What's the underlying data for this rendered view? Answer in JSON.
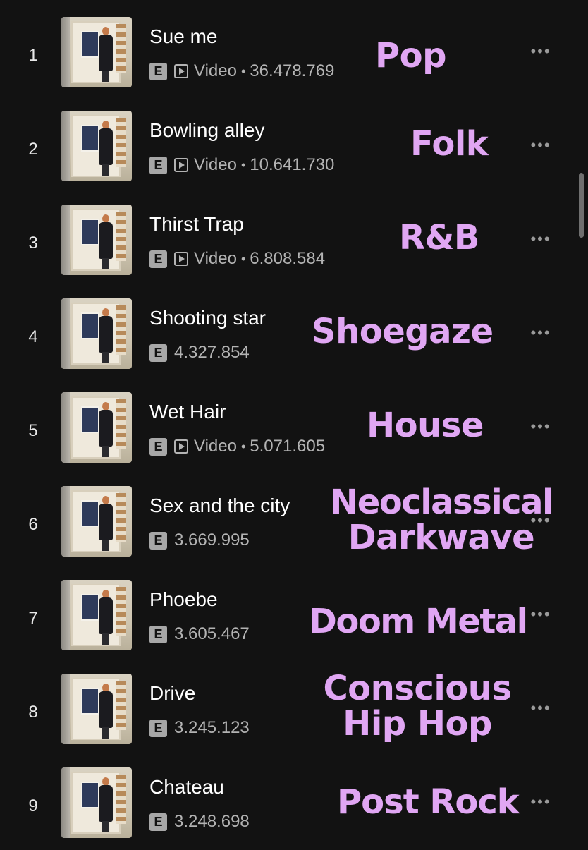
{
  "tracks": [
    {
      "rank": "1",
      "title": "Sue me",
      "explicit": "E",
      "video": "Video",
      "sep": "•",
      "plays": "36.478.769",
      "more": "•••",
      "genre": "Pop"
    },
    {
      "rank": "2",
      "title": "Bowling alley",
      "explicit": "E",
      "video": "Video",
      "sep": "•",
      "plays": "10.641.730",
      "more": "•••",
      "genre": "Folk"
    },
    {
      "rank": "3",
      "title": "Thirst Trap",
      "explicit": "E",
      "video": "Video",
      "sep": "•",
      "plays": "6.808.584",
      "more": "•••",
      "genre": "R&B"
    },
    {
      "rank": "4",
      "title": "Shooting star",
      "explicit": "E",
      "video": "",
      "sep": "",
      "plays": "4.327.854",
      "more": "•••",
      "genre": "Shoegaze"
    },
    {
      "rank": "5",
      "title": "Wet Hair",
      "explicit": "E",
      "video": "Video",
      "sep": "•",
      "plays": "5.071.605",
      "more": "•••",
      "genre": "House"
    },
    {
      "rank": "6",
      "title": "Sex and the city",
      "explicit": "E",
      "video": "",
      "sep": "",
      "plays": "3.669.995",
      "more": "•••",
      "genre_lines": [
        "Neoclassical",
        "Darkwave"
      ]
    },
    {
      "rank": "7",
      "title": "Phoebe",
      "explicit": "E",
      "video": "",
      "sep": "",
      "plays": "3.605.467",
      "more": "•••",
      "genre": "Doom Metal"
    },
    {
      "rank": "8",
      "title": "Drive",
      "explicit": "E",
      "video": "",
      "sep": "",
      "plays": "3.245.123",
      "more": "•••",
      "genre_lines": [
        "Conscious",
        "Hip Hop"
      ]
    },
    {
      "rank": "9",
      "title": "Chateau",
      "explicit": "E",
      "video": "",
      "sep": "",
      "plays": "3.248.698",
      "more": "•••",
      "genre": "Post Rock"
    }
  ],
  "colors": {
    "background": "#121212",
    "genre_overlay": "#e0a6f3",
    "secondary_text": "#b3b3b3"
  },
  "icons": {
    "thumbnail": "album-cover-image",
    "explicit": "explicit-badge",
    "video": "video-play-icon",
    "more": "more-options-icon"
  }
}
